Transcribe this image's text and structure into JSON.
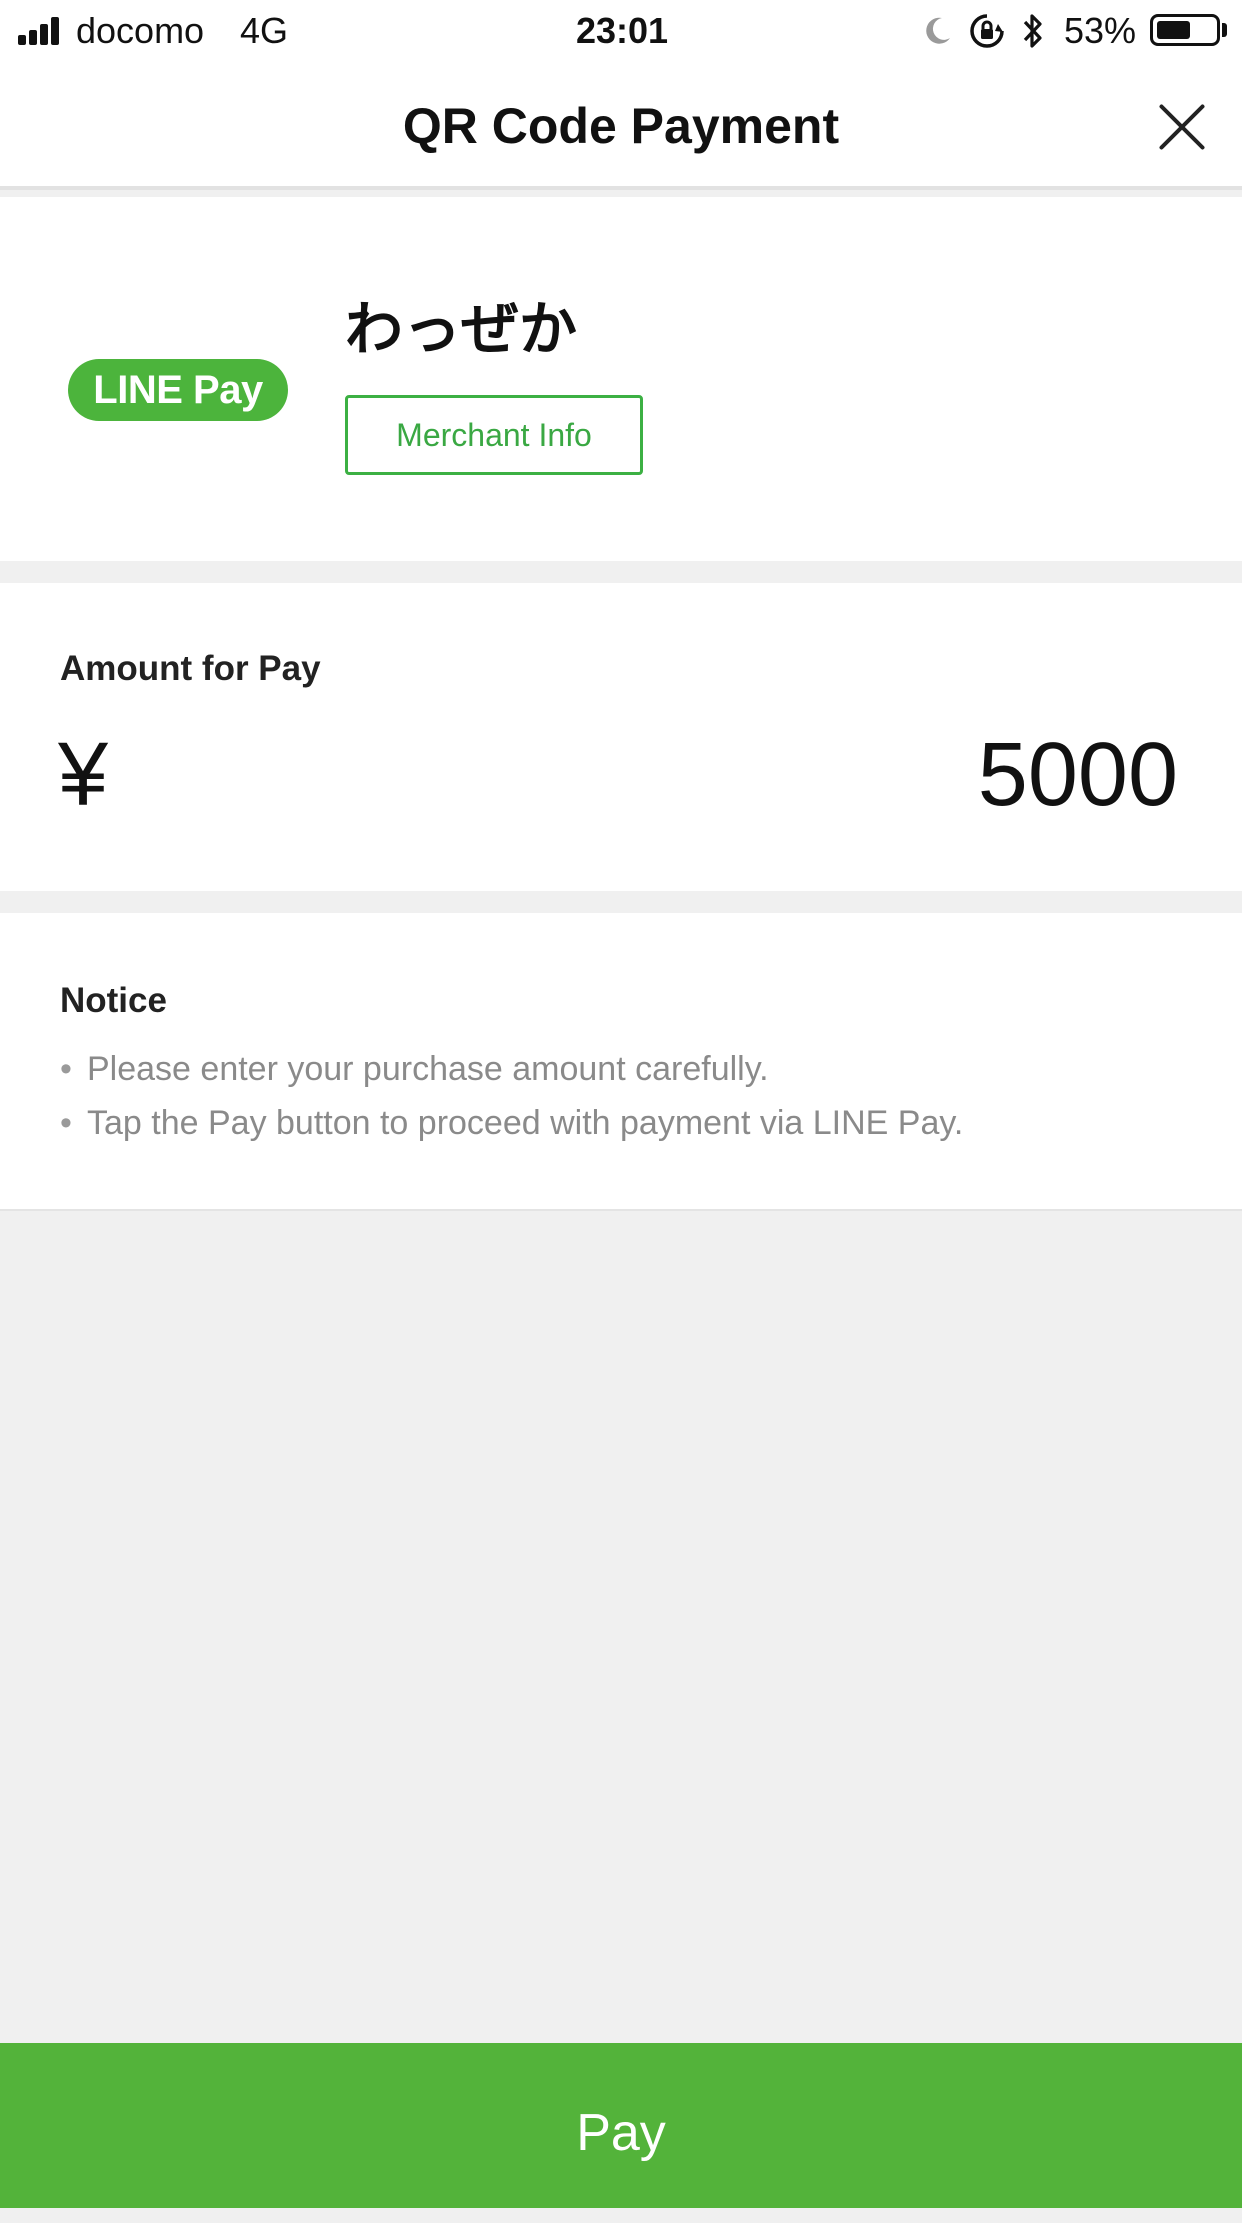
{
  "status_bar": {
    "carrier": "docomo",
    "network": "4G",
    "time": "23:01",
    "battery_percent": "53%",
    "battery_level": 0.53,
    "icons": [
      "signal-icon",
      "moon-icon",
      "orientation-lock-icon",
      "bluetooth-icon",
      "battery-icon"
    ]
  },
  "header": {
    "title": "QR Code Payment",
    "close_icon": "close-icon"
  },
  "merchant": {
    "logo_text": "LINE Pay",
    "name": "わっぜか",
    "info_button": "Merchant Info"
  },
  "amount": {
    "label": "Amount for Pay",
    "currency_symbol": "¥",
    "value": "5000"
  },
  "notice": {
    "title": "Notice",
    "items": [
      "Please enter your purchase amount carefully.",
      "Tap the Pay button to proceed with payment via LINE Pay."
    ]
  },
  "footer": {
    "pay_button": "Pay"
  },
  "colors": {
    "accent_green": "#53b33a",
    "logo_green": "#4cb43c",
    "background": "#f0f0f0"
  }
}
